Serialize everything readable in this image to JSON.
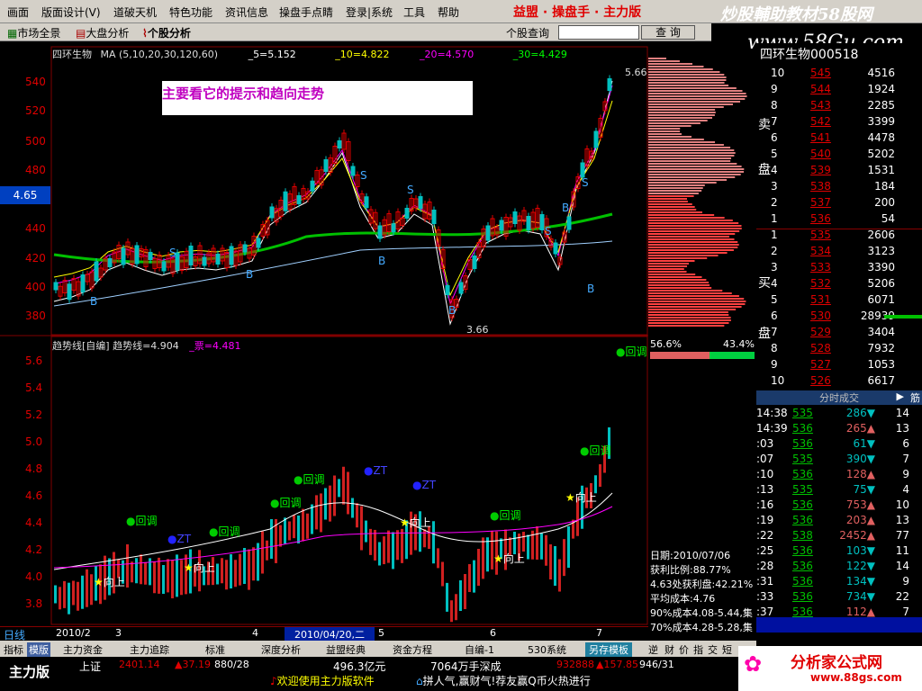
{
  "menubar": {
    "items": [
      "画面",
      "版面设计(V)",
      "道破天机",
      "特色功能",
      "资讯信息",
      "操盘手点睛",
      "登录|系统",
      "工具",
      "帮助"
    ],
    "brand": "益盟 · 操盘手 · 主力版",
    "watermark_top": "炒股輔助教材58股网",
    "watermark_url": "www.58Gu.com"
  },
  "toolbar": {
    "market_view": "市场全景",
    "index_analysis": "大盘分析",
    "stock_analysis": "个股分析",
    "search_label": "个股查询",
    "search_button": "查 询"
  },
  "main_chart": {
    "stock_name": "四环生物",
    "ma_legend": "MA (5,10,20,30,120,60)",
    "ma5": "_5=5.152",
    "ma10": "_10=4.822",
    "ma20": "_20=4.570",
    "ma30": "_30=4.429",
    "current_price_tag": "4.65",
    "high_label": "5.66",
    "low_label": "3.66",
    "y_ticks": [
      "540",
      "520",
      "500",
      "480",
      "460",
      "440",
      "420",
      "400",
      "380"
    ],
    "hint": "主要看它的提示和趋向走势",
    "signals": [
      "B",
      "B",
      "B",
      "B",
      "B",
      "B",
      "S",
      "S",
      "S",
      "S",
      "S"
    ]
  },
  "indicator": {
    "legend": "趋势线[自编] 趋势线=4.904",
    "legend2": "_票=4.481",
    "y_ticks": [
      "5.6",
      "5.4",
      "5.2",
      "5.0",
      "4.8",
      "4.6",
      "4.4",
      "4.2",
      "4.0",
      "3.8"
    ],
    "labels": {
      "huitiao": "回调",
      "xiangshang": "向上",
      "zt": "ZT"
    }
  },
  "bottom_axis": {
    "period": "日线",
    "dates": [
      "2010/2",
      "3",
      "4",
      "2010/04/20,二",
      "5",
      "6",
      "7"
    ]
  },
  "tabs": [
    "指标",
    "模版",
    "主力资金",
    "主力追踪",
    "标准",
    "深度分析",
    "益盟经典",
    "资金方程",
    "自编-1",
    "530系统",
    "另存模板",
    "逆",
    "财",
    "价",
    "指",
    "交",
    "短"
  ],
  "status": {
    "edition": "主力版",
    "index_name": "上证",
    "index_value": "2401.14",
    "index_change": "▲37.19",
    "index_counts": "880/28",
    "turnover": "496.3亿元",
    "shenzhen": "7064万手深成",
    "sz_value": "932888",
    "sz_change": "▲157.85",
    "sz_counts": "946/31",
    "welcome": "欢迎使用主力版软件",
    "slogan": "拼人气,赢财气!荐友赢Q币火热进行",
    "site": "分析家公式网",
    "site_url": "www.88gs.com"
  },
  "profile": {
    "left_pct": "56.6%",
    "right_pct": "43.4%",
    "date": "日期:2010/07/06",
    "profit_ratio": "获利比例:88.77%",
    "profit_at": "4.63处获利盘:42.21%",
    "avg_cost": "平均成本:4.76",
    "cost90": "90%成本4.08-5.44,集",
    "cost70": "70%成本4.28-5.28,集"
  },
  "right_panel": {
    "header": "四环生物000518",
    "sell_label": [
      "卖",
      "盘"
    ],
    "buy_label": [
      "买",
      "盘"
    ],
    "sell_orders": [
      {
        "level": "10",
        "price": "545",
        "vol": "4516"
      },
      {
        "level": "9",
        "price": "544",
        "vol": "1924"
      },
      {
        "level": "8",
        "price": "543",
        "vol": "2285"
      },
      {
        "level": "7",
        "price": "542",
        "vol": "3399"
      },
      {
        "level": "6",
        "price": "541",
        "vol": "4478"
      },
      {
        "level": "5",
        "price": "540",
        "vol": "5202"
      },
      {
        "level": "4",
        "price": "539",
        "vol": "1531"
      },
      {
        "level": "3",
        "price": "538",
        "vol": "184"
      },
      {
        "level": "2",
        "price": "537",
        "vol": "200"
      },
      {
        "level": "1",
        "price": "536",
        "vol": "54"
      }
    ],
    "buy_orders": [
      {
        "level": "1",
        "price": "535",
        "vol": "2606"
      },
      {
        "level": "2",
        "price": "534",
        "vol": "3123"
      },
      {
        "level": "3",
        "price": "533",
        "vol": "3390"
      },
      {
        "level": "4",
        "price": "532",
        "vol": "5206"
      },
      {
        "level": "5",
        "price": "531",
        "vol": "6071"
      },
      {
        "level": "6",
        "price": "530",
        "vol": "28939"
      },
      {
        "level": "7",
        "price": "529",
        "vol": "3404"
      },
      {
        "level": "8",
        "price": "528",
        "vol": "7932"
      },
      {
        "level": "9",
        "price": "527",
        "vol": "1053"
      },
      {
        "level": "10",
        "price": "526",
        "vol": "6617"
      }
    ],
    "trade_header": "分时成交",
    "trade_tab": "筋",
    "trades": [
      {
        "time": "14:38",
        "price": "535",
        "vol": "286▼",
        "n": "14"
      },
      {
        "time": "14:39",
        "price": "536",
        "vol": "265▲",
        "n": "13"
      },
      {
        "time": ":03",
        "price": "536",
        "vol": "61▼",
        "n": "6"
      },
      {
        "time": ":07",
        "price": "535",
        "vol": "390▼",
        "n": "7"
      },
      {
        "time": ":10",
        "price": "536",
        "vol": "128▲",
        "n": "9"
      },
      {
        "time": ":13",
        "price": "535",
        "vol": "75▼",
        "n": "4"
      },
      {
        "time": ":16",
        "price": "536",
        "vol": "753▲",
        "n": "10"
      },
      {
        "time": ":19",
        "price": "536",
        "vol": "203▲",
        "n": "13"
      },
      {
        "time": ":22",
        "price": "538",
        "vol": "2452▲",
        "n": "77"
      },
      {
        "time": ":25",
        "price": "536",
        "vol": "103▼",
        "n": "11"
      },
      {
        "time": ":28",
        "price": "536",
        "vol": "122▼",
        "n": "14"
      },
      {
        "time": ":31",
        "price": "536",
        "vol": "134▼",
        "n": "9"
      },
      {
        "time": ":33",
        "price": "536",
        "vol": "734▼",
        "n": "22"
      },
      {
        "time": ":37",
        "price": "536",
        "vol": "112▲",
        "n": "7"
      }
    ]
  },
  "colors": {
    "up": "#e00000",
    "down": "#00c0c0",
    "ma_green": "#00c000",
    "brand_red": "#e00000",
    "buy_green": "#00c000"
  }
}
